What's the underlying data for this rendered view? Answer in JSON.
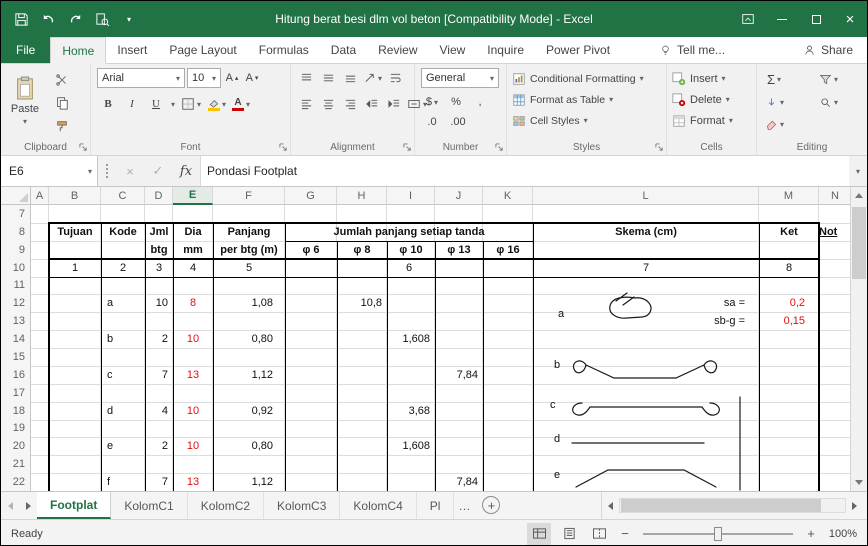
{
  "colors": {
    "accent_green": "#217346",
    "value_red": "#e01010"
  },
  "window": {
    "title": "Hitung berat besi dlm vol beton  [Compatibility Mode] - Excel"
  },
  "ribbon_tabs": [
    "File",
    "Home",
    "Insert",
    "Page Layout",
    "Formulas",
    "Data",
    "Review",
    "View",
    "Inquire",
    "Power Pivot"
  ],
  "ribbon_right": {
    "tell_me": "Tell me...",
    "share": "Share"
  },
  "ribbon": {
    "paste": "Paste",
    "font_name": "Arial",
    "font_size": "10",
    "bold": "B",
    "italic": "I",
    "underline": "U",
    "grow_font": "A",
    "shrink_font": "A",
    "font_color_letter": "A",
    "number_format": "General",
    "accounting": "$",
    "percent": "%",
    "comma": ",",
    "inc_decimal": ".0",
    "dec_decimal": ".00",
    "autosum": "Σ",
    "styles_buttons": [
      "Conditional Formatting",
      "Format as Table",
      "Cell Styles"
    ],
    "cells_buttons": [
      "Insert",
      "Delete",
      "Format"
    ],
    "group_labels": [
      "Clipboard",
      "Font",
      "Alignment",
      "Number",
      "Styles",
      "Cells",
      "Editing"
    ]
  },
  "formula_bar": {
    "name_box": "E6",
    "fx": "fx",
    "value": "Pondasi Footplat"
  },
  "grid": {
    "columns": [
      "A",
      "B",
      "C",
      "D",
      "E",
      "F",
      "G",
      "H",
      "I",
      "J",
      "K",
      "L",
      "M",
      "N"
    ],
    "selected_column": "E",
    "first_row": 7,
    "last_row": 22
  },
  "table": {
    "header": {
      "tujuan": "Tujuan",
      "kode": "Kode",
      "jml": "Jml",
      "btg": "btg",
      "dia": "Dia",
      "mm": "mm",
      "panjang": "Panjang",
      "per_btg": "per btg (m)",
      "jumlah": "Jumlah panjang setiap tanda",
      "dias": [
        "φ 6",
        "φ 8",
        "φ 10",
        "φ 13",
        "φ 16"
      ],
      "skema": "Skema (cm)",
      "ket": "Ket",
      "numbers": [
        "1",
        "2",
        "3",
        "4",
        "5",
        "6",
        "7",
        "8"
      ]
    },
    "rows": [
      {
        "kode": "a",
        "jml": "10",
        "dia": "8",
        "panjang": "1,08",
        "tanda_col": "H",
        "tanda": "10,8"
      },
      {
        "kode": "b",
        "jml": "2",
        "dia": "10",
        "panjang": "0,80",
        "tanda_col": "I",
        "tanda": "1,608"
      },
      {
        "kode": "c",
        "jml": "7",
        "dia": "13",
        "panjang": "1,12",
        "tanda_col": "J",
        "tanda": "7,84"
      },
      {
        "kode": "d",
        "jml": "4",
        "dia": "10",
        "panjang": "0,92",
        "tanda_col": "I",
        "tanda": "3,68"
      },
      {
        "kode": "e",
        "jml": "2",
        "dia": "10",
        "panjang": "0,80",
        "tanda_col": "I",
        "tanda": "1,608"
      },
      {
        "kode": "f",
        "jml": "7",
        "dia": "13",
        "panjang": "1,12",
        "tanda_col": "J",
        "tanda": "7,84"
      }
    ],
    "ket_rows": [
      {
        "label": "sa =",
        "value": "0,2"
      },
      {
        "label": "sb-g =",
        "value": "0,15"
      }
    ],
    "skema_labels": [
      "a",
      "b",
      "c",
      "d",
      "e"
    ],
    "note": "Not"
  },
  "sheet_tabs": {
    "tabs": [
      "Footplat",
      "KolomC1",
      "KolomC2",
      "KolomC3",
      "KolomC4",
      "Pl"
    ],
    "active": "Footplat",
    "more": "…"
  },
  "status_bar": {
    "mode": "Ready",
    "zoom": "100%",
    "zoom_out": "−",
    "zoom_in": "+"
  }
}
